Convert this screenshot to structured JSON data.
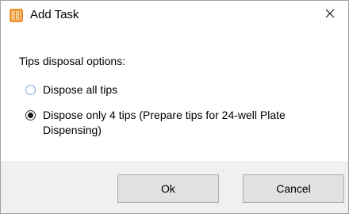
{
  "window": {
    "title": "Add Task",
    "icon": "app-grid-icon",
    "close_icon": "close-icon"
  },
  "dialog": {
    "prompt": "Tips disposal options:",
    "options": [
      {
        "label": "Dispose all tips",
        "selected": false
      },
      {
        "label": "Dispose only 4 tips (Prepare tips for 24-well Plate Dispensing)",
        "selected": true
      }
    ]
  },
  "buttons": {
    "ok_label": "Ok",
    "cancel_label": "Cancel"
  },
  "colors": {
    "icon_accent": "#f5a142",
    "footer_bg": "#f0f0f0",
    "button_bg": "#e1e1e1",
    "button_border": "#adadad"
  }
}
